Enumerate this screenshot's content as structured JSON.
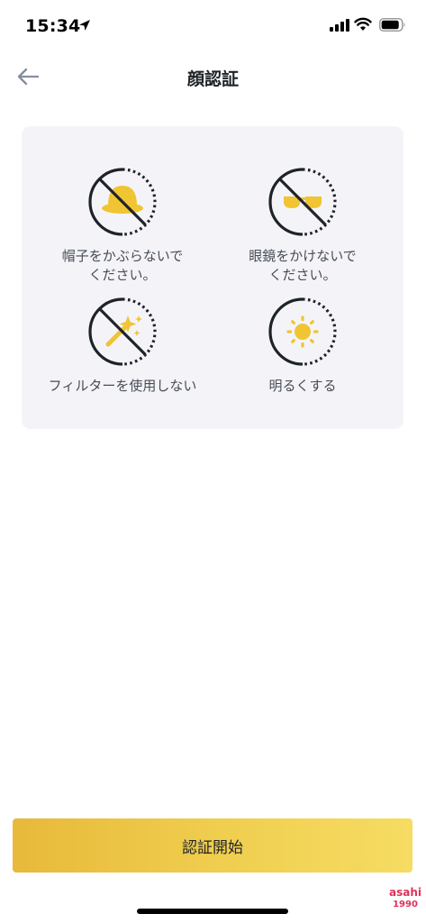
{
  "status_bar": {
    "time": "15:34"
  },
  "header": {
    "title": "顔認証"
  },
  "tips": [
    {
      "label": "帽子をかぶらないで\nください。",
      "icon": "no-hat-icon"
    },
    {
      "label": "眼鏡をかけないで\nください。",
      "icon": "no-glasses-icon"
    },
    {
      "label": "フィルターを使用しない",
      "icon": "no-filter-icon"
    },
    {
      "label": "明るくする",
      "icon": "brightness-icon"
    }
  ],
  "actions": {
    "start_label": "認証開始"
  },
  "watermark": {
    "line1": "asahi",
    "line2": "1990"
  },
  "colors": {
    "accent": "#F0CF50",
    "icon_yellow": "#F0C433",
    "card_bg": "#F4F4F8",
    "text": "#1E2329",
    "subtext": "#474D57"
  }
}
